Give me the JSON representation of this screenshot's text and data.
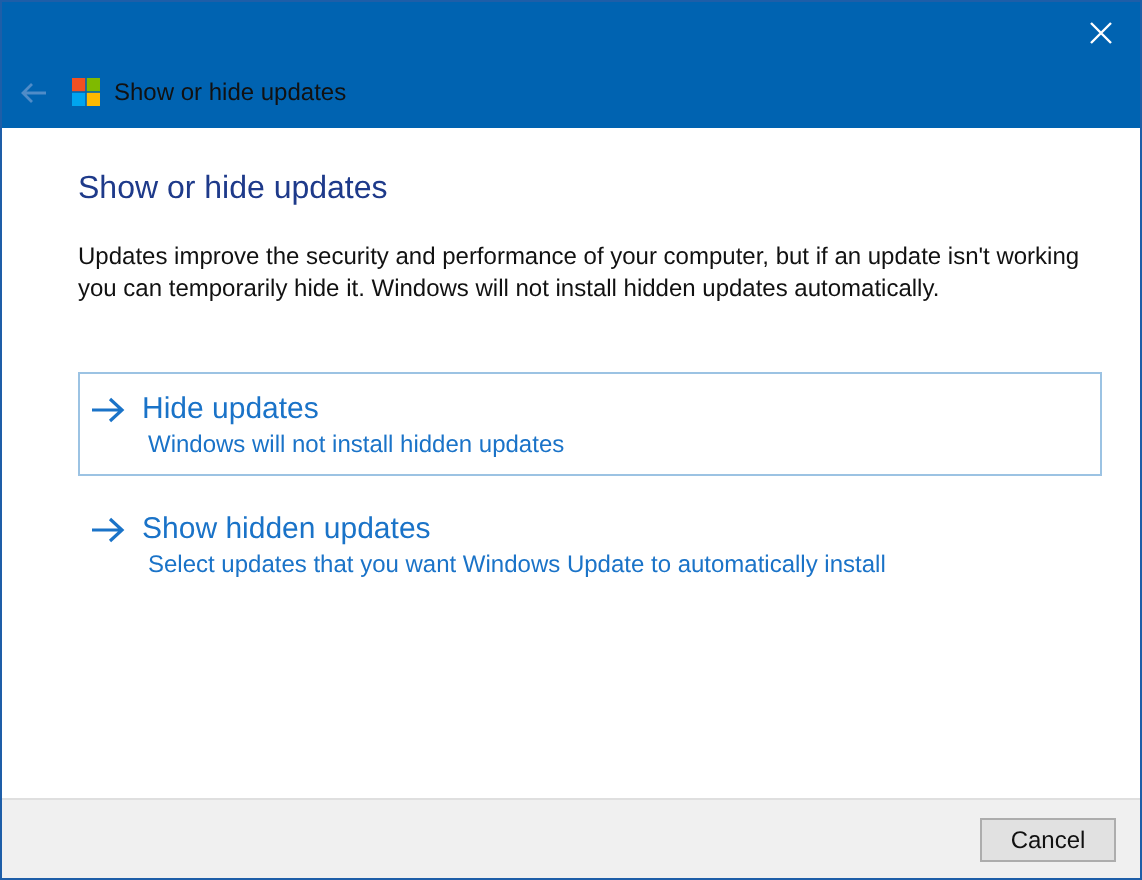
{
  "window": {
    "title": "Show or hide updates",
    "back_disabled": true
  },
  "heading": "Show or hide updates",
  "description": "Updates improve the security and performance of your computer, but if an update isn't working\nyou can temporarily hide it. Windows will not install hidden updates automatically.",
  "options": [
    {
      "title": "Hide updates",
      "subtitle": "Windows will not install hidden updates",
      "selected": true
    },
    {
      "title": "Show hidden updates",
      "subtitle": "Select updates that you want Windows Update to automatically install",
      "selected": false
    }
  ],
  "buttons": [
    "Cancel"
  ]
}
